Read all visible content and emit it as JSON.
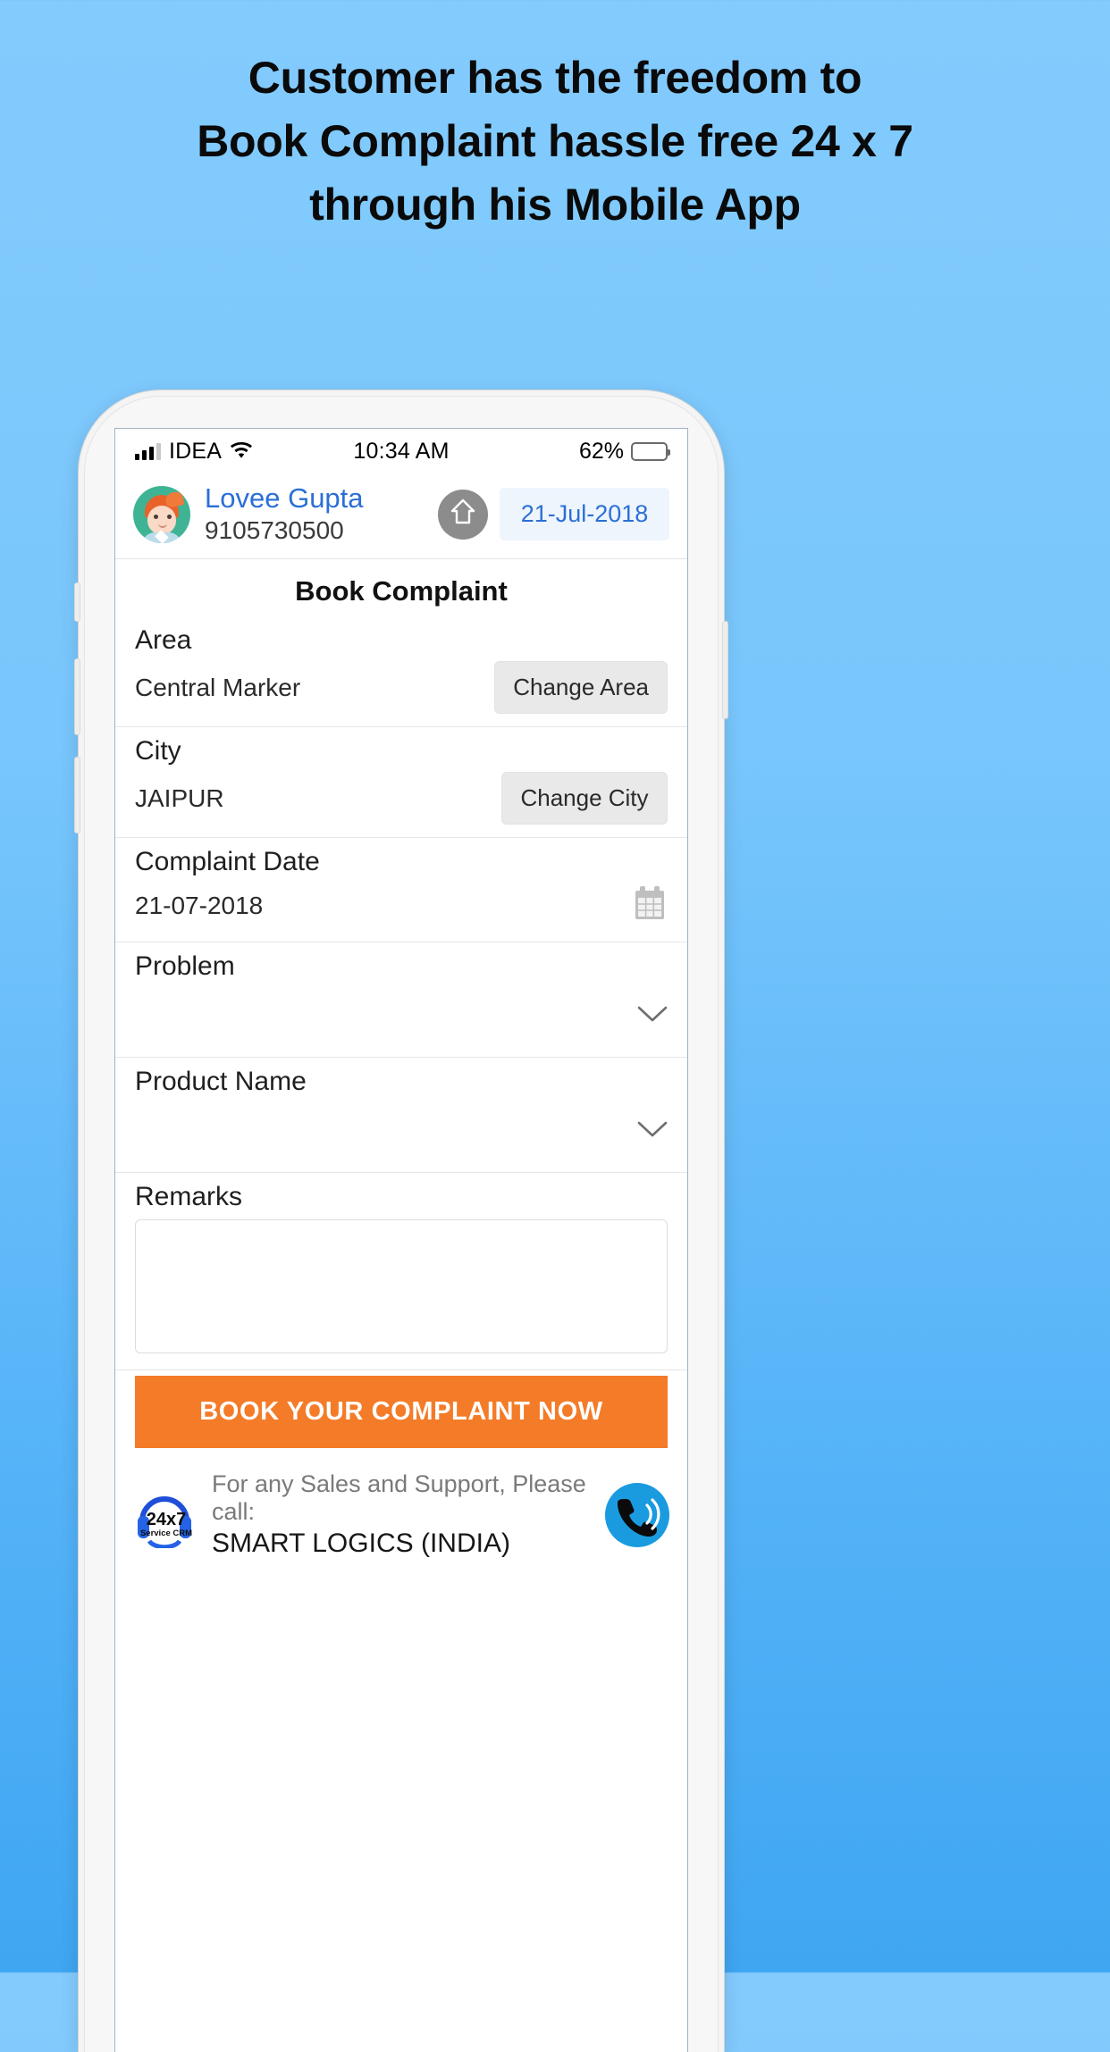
{
  "promo": {
    "headline_lines": [
      "Customer has the freedom to",
      "Book Complaint hassle free 24 x 7",
      "through his Mobile App"
    ],
    "background_color_top": "#83CBFD",
    "background_color_bottom": "#3FA6F2"
  },
  "status_bar": {
    "carrier": "IDEA",
    "time": "10:34 AM",
    "battery_percent": "62%",
    "battery_level": 62,
    "signal_bars_filled": 3,
    "signal_bars_total": 4,
    "wifi_icon": "wifi-icon"
  },
  "app_header": {
    "user_name": "Lovee Gupta",
    "user_phone": "9105730500",
    "home_icon": "home-icon",
    "date": "21-Jul-2018",
    "name_color": "#2B6FD6",
    "date_chip_bg": "#EEF5FD"
  },
  "form": {
    "title": "Book Complaint",
    "fields": [
      {
        "label": "Area",
        "value": "Central Marker",
        "action_label": "Change Area",
        "control": "button"
      },
      {
        "label": "City",
        "value": "JAIPUR",
        "action_label": "Change City",
        "control": "button"
      },
      {
        "label": "Complaint Date",
        "value": "21-07-2018",
        "action_label": "",
        "control": "calendar"
      },
      {
        "label": "Problem",
        "value": "",
        "action_label": "",
        "control": "dropdown"
      },
      {
        "label": "Product Name",
        "value": "",
        "action_label": "",
        "control": "dropdown"
      }
    ],
    "remarks_label": "Remarks",
    "remarks_value": "",
    "remarks_placeholder": "",
    "submit_label": "BOOK YOUR COMPLAINT NOW",
    "submit_color": "#F47B28"
  },
  "footer": {
    "logo_text_top": "24x7",
    "logo_text_bottom": "Service CRM",
    "line1": "For any Sales and Support, Please call:",
    "line2": "SMART LOGICS (INDIA)",
    "call_icon": "phone-call-icon",
    "call_icon_color": "#1A9BE0"
  }
}
